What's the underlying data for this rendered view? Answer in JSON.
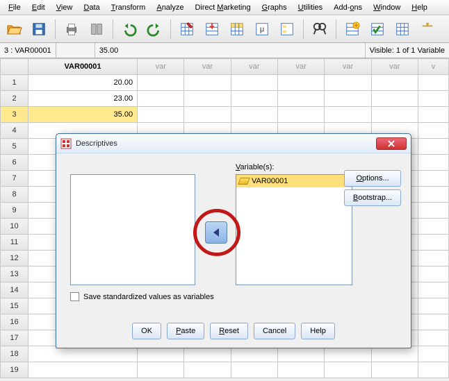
{
  "menu": {
    "items": [
      "File",
      "Edit",
      "View",
      "Data",
      "Transform",
      "Analyze",
      "Direct Marketing",
      "Graphs",
      "Utilities",
      "Add-ons",
      "Window",
      "Help"
    ]
  },
  "toolbar_icons": [
    "open-file-icon",
    "save-icon",
    "print-icon",
    "recall-icon",
    "undo-icon",
    "redo-icon",
    "goto-case-icon",
    "goto-variable-icon",
    "variables-icon",
    "run-icon",
    "value-labels-icon",
    "find-icon",
    "insert-case-icon",
    "select-cases-icon",
    "weight-cases-icon",
    "split-file-icon"
  ],
  "info": {
    "cell_ref": "3 : VAR00001",
    "cell_value": "35.00",
    "visible": "Visible: 1 of 1 Variable"
  },
  "grid": {
    "columns": [
      "VAR00001",
      "var",
      "var",
      "var",
      "var",
      "var",
      "var",
      "v"
    ],
    "rows": [
      {
        "n": "1",
        "v": "20.00"
      },
      {
        "n": "2",
        "v": "23.00"
      },
      {
        "n": "3",
        "v": "35.00",
        "sel": true
      },
      {
        "n": "4",
        "v": ""
      },
      {
        "n": "5",
        "v": ""
      },
      {
        "n": "6",
        "v": ""
      },
      {
        "n": "7",
        "v": ""
      },
      {
        "n": "8",
        "v": ""
      },
      {
        "n": "9",
        "v": ""
      },
      {
        "n": "10",
        "v": ""
      },
      {
        "n": "11",
        "v": ""
      },
      {
        "n": "12",
        "v": ""
      },
      {
        "n": "13",
        "v": ""
      },
      {
        "n": "14",
        "v": ""
      },
      {
        "n": "15",
        "v": ""
      },
      {
        "n": "16",
        "v": ""
      },
      {
        "n": "17",
        "v": ""
      },
      {
        "n": "18",
        "v": ""
      },
      {
        "n": "19",
        "v": ""
      }
    ]
  },
  "dialog": {
    "title": "Descriptives",
    "vars_label": "Variable(s):",
    "selected_var": "VAR00001",
    "options_btn": "Options...",
    "bootstrap_btn": "Bootstrap...",
    "save_chk": "Save standardized values as variables",
    "ok": "OK",
    "paste": "Paste",
    "reset": "Reset",
    "cancel": "Cancel",
    "help": "Help"
  }
}
